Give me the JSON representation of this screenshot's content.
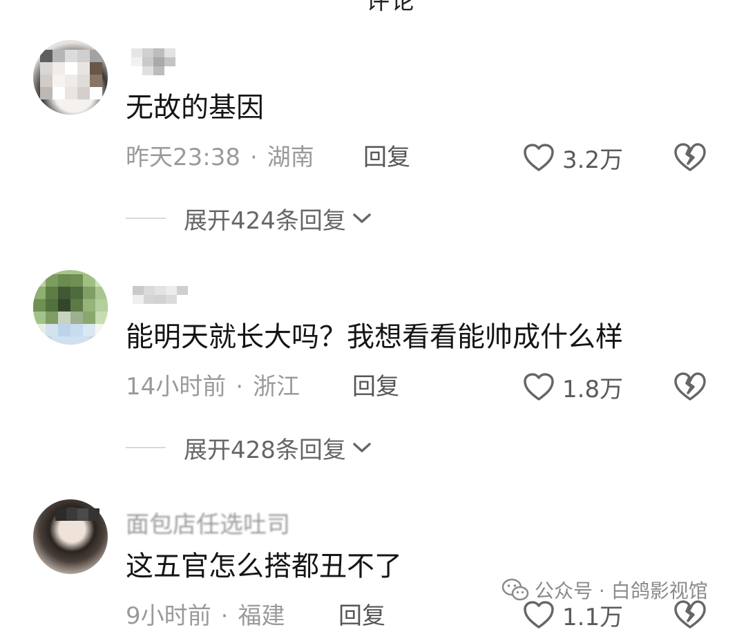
{
  "header": {
    "title_fragment": "评论"
  },
  "comments": [
    {
      "username": "一司",
      "text": "无故的基因",
      "time": "昨天23:38",
      "location": "湖南",
      "reply_label": "回复",
      "likes": "3.2万",
      "expand_label": "展开424条回复"
    },
    {
      "username": "",
      "text": "能明天就长大吗？我想看看能帅成什么样",
      "time": "14小时前",
      "location": "浙江",
      "reply_label": "回复",
      "likes": "1.8万",
      "expand_label": "展开428条回复"
    },
    {
      "username": "面包店任选吐司",
      "text": "这五官怎么搭都丑不了",
      "time": "9小时前",
      "location": "福建",
      "reply_label": "回复",
      "likes": "1.1万"
    }
  ],
  "meta_separator": "·",
  "watermark": {
    "text": "公众号 · 白鸽影视馆",
    "icon": "wechat-icon"
  },
  "icons": {
    "like": "heart-outline-icon",
    "dislike": "broken-heart-icon",
    "expand": "chevron-down-icon"
  },
  "colors": {
    "text_primary": "#151515",
    "text_meta": "#9a9a9a",
    "icon": "#666666"
  }
}
